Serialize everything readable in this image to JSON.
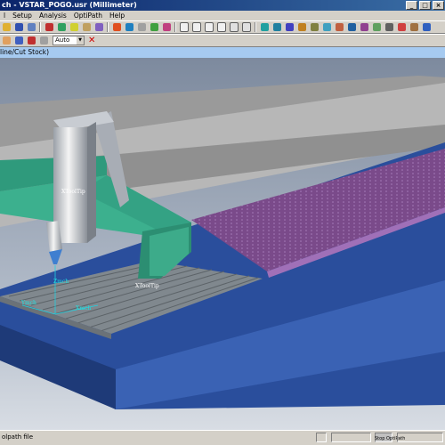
{
  "window": {
    "title": "ch - VSTAR_POGO.usr (Millimeter)"
  },
  "menu": [
    "l",
    "Setup",
    "Analysis",
    "OptiPath",
    "Help"
  ],
  "toolbar2": {
    "combo_value": "Auto"
  },
  "view": {
    "header": "line/Cut Stock)"
  },
  "scene_labels": {
    "tool_tip": "XToolTip",
    "zmch": "Zmch",
    "xmch": "Xmch",
    "ymch": "Ymch",
    "xtool_tip2": "XToolTip"
  },
  "status": {
    "message": "olpath file",
    "optipath_label": "Stop OptiPath"
  },
  "colors": {
    "titlebar": "#0a246a",
    "view_header": "#a6caf0",
    "gantry": "#3aa88a",
    "stock": "#7a4a8a",
    "bed": "#284c9a"
  }
}
